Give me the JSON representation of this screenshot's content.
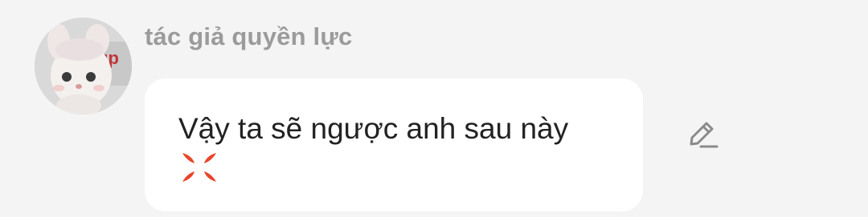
{
  "comment": {
    "author": "tác giả quyền lực",
    "message_text": "Vậy ta sẽ ngược anh sau này",
    "emoji": "anger-symbol-icon",
    "edit_icon": "pencil-edit-icon",
    "avatar_icon": "cat-avatar"
  },
  "colors": {
    "background": "#f4f4f4",
    "bubble": "#ffffff",
    "author_text": "#9b9b9b",
    "message_text": "#222222",
    "emoji": "#e8442a",
    "edit_icon": "#8a8a8a"
  }
}
